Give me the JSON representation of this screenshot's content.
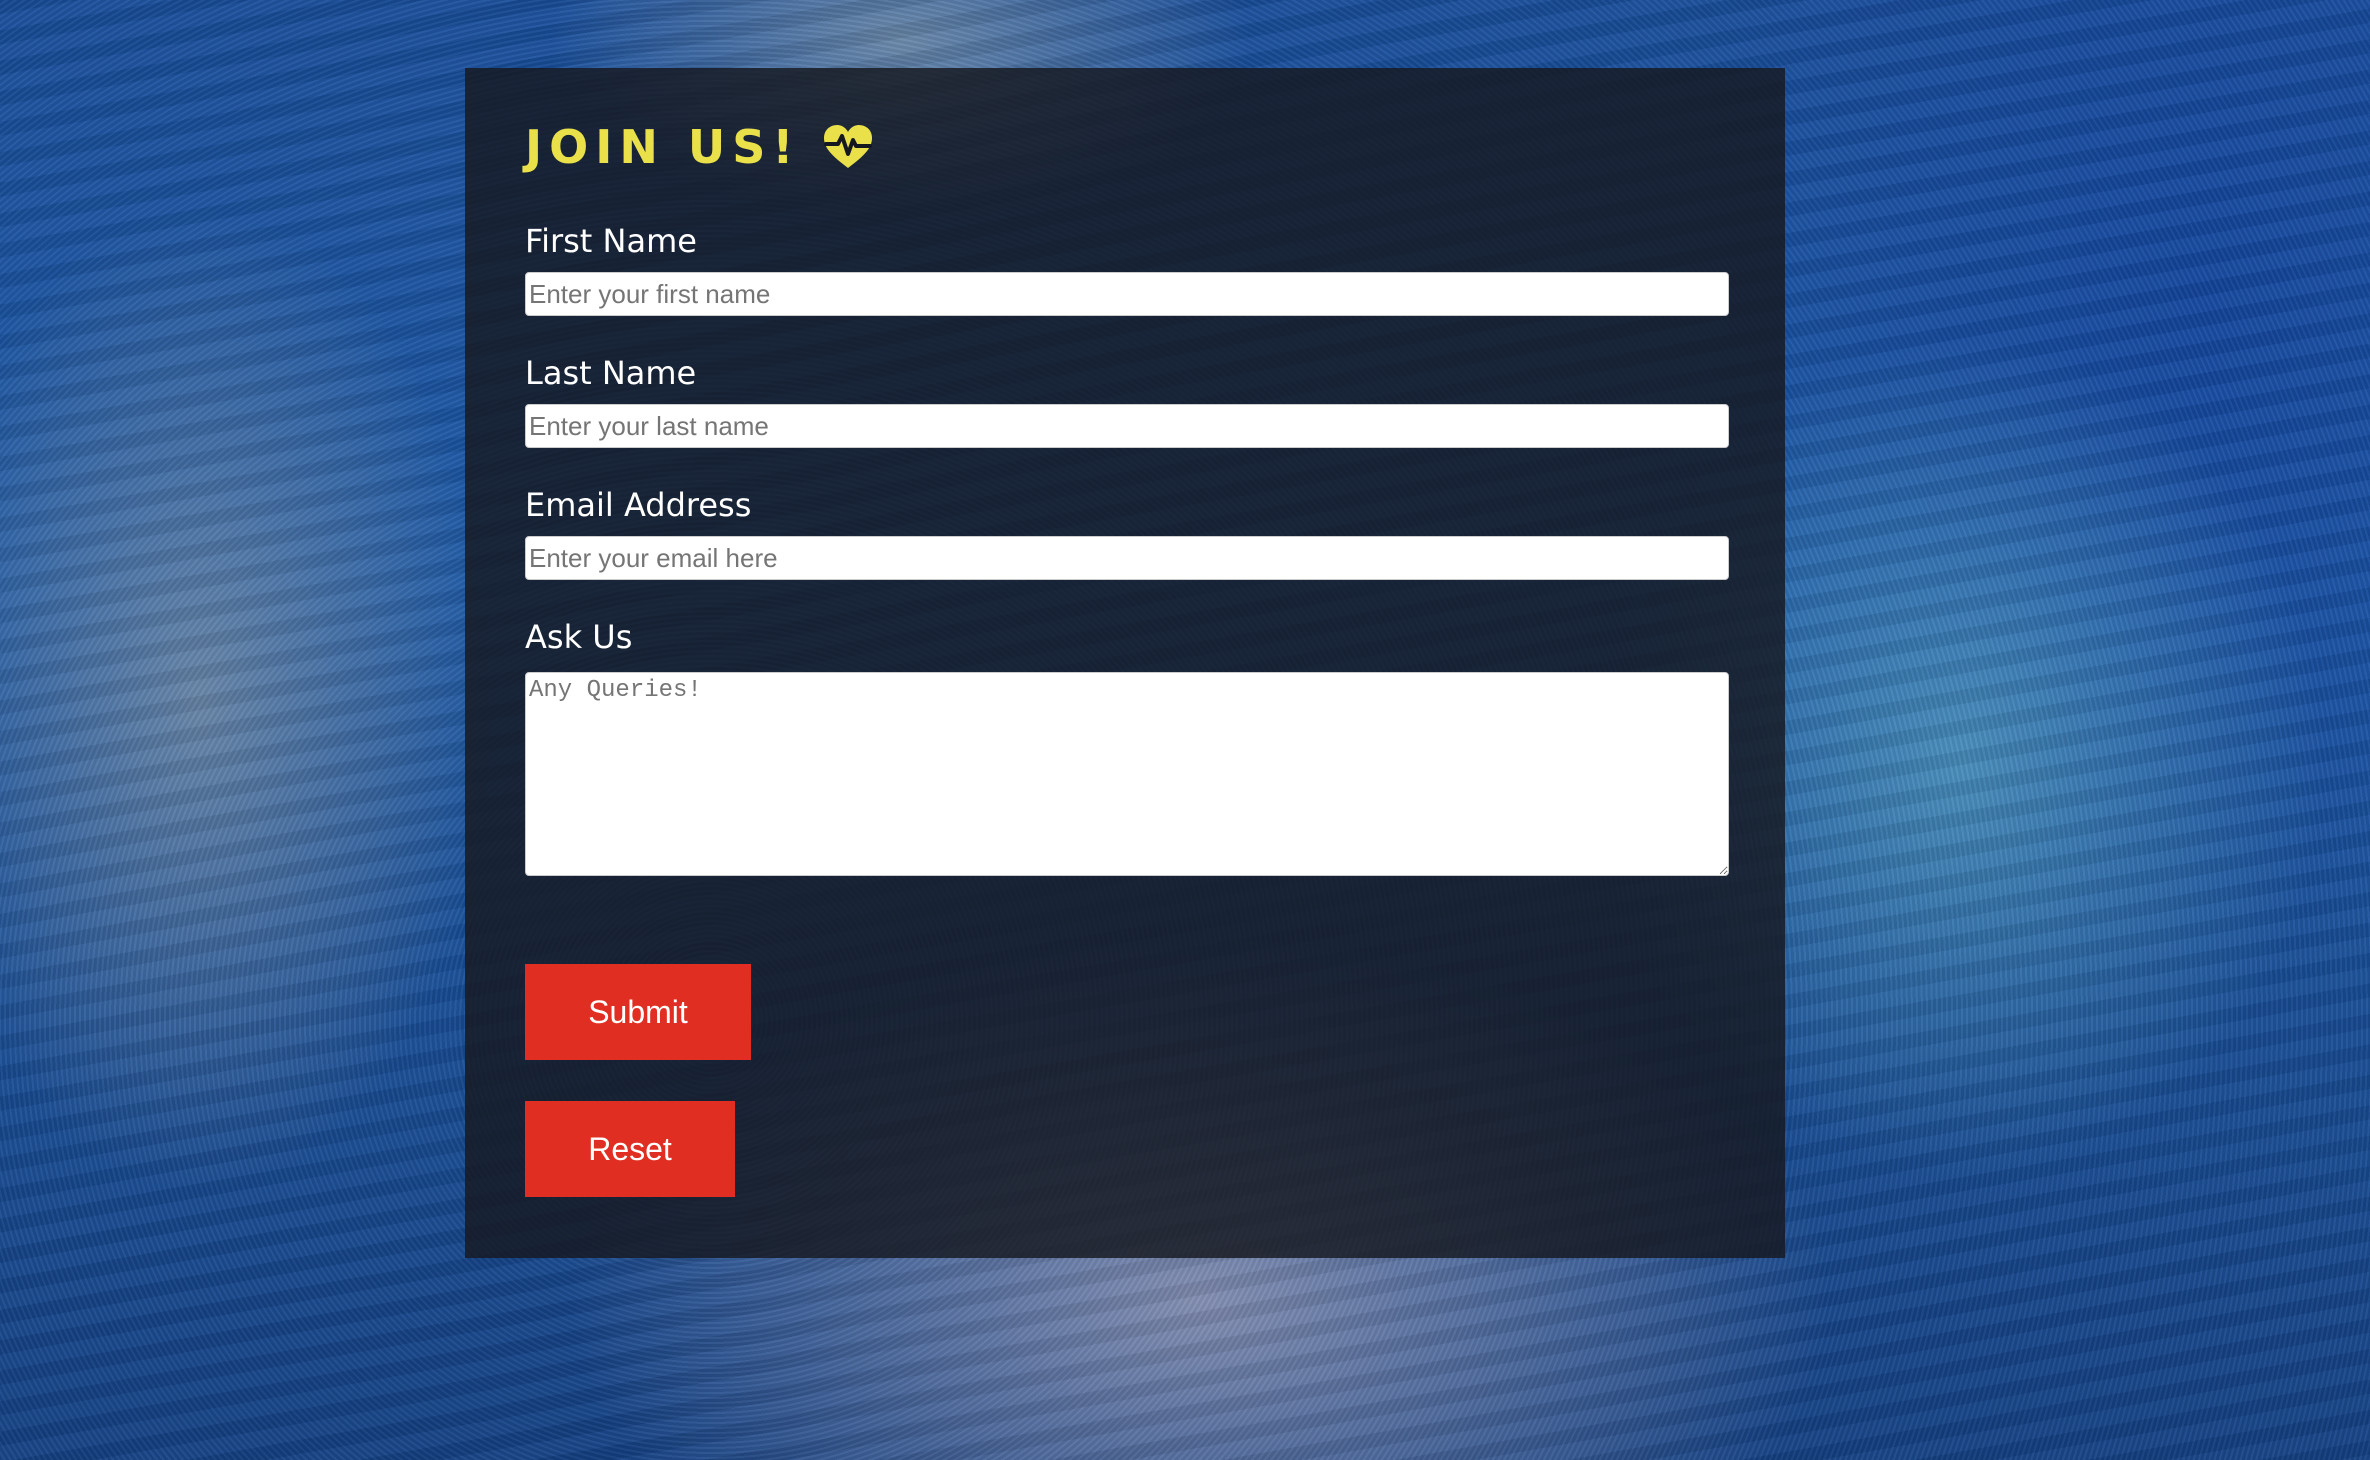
{
  "form": {
    "title": "JOIN US!",
    "title_icon": "heart-pulse-icon",
    "fields": {
      "first_name": {
        "label": "First Name",
        "placeholder": "Enter your first name"
      },
      "last_name": {
        "label": "Last Name",
        "placeholder": "Enter your last name"
      },
      "email": {
        "label": "Email Address",
        "placeholder": "Enter your email here"
      },
      "ask_us": {
        "label": "Ask Us",
        "placeholder": "Any Queries!"
      }
    },
    "buttons": {
      "submit": "Submit",
      "reset": "Reset"
    }
  },
  "colors": {
    "title": "#e9e04a",
    "button": "#e02f22",
    "panel": "#16181f"
  }
}
